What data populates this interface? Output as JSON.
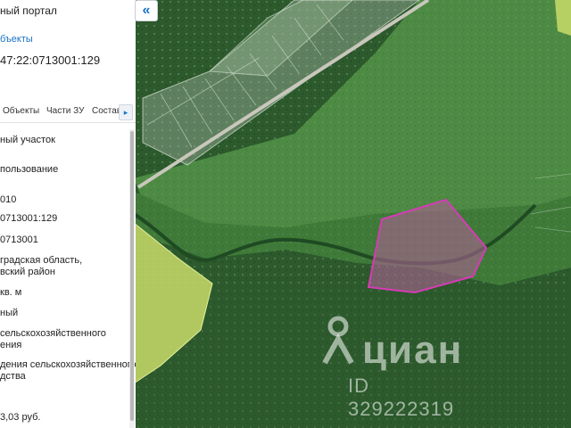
{
  "panel": {
    "portal_title": "ный портал",
    "objects_link": "бъекты",
    "cadastral_number": "47:22:0713001:129",
    "tabs": [
      {
        "label": "Объекты"
      },
      {
        "label": "Части ЗУ"
      },
      {
        "label": "Состав"
      }
    ],
    "tab_next": "▸",
    "fields": {
      "type": "ный участок",
      "usage": "пользование",
      "code": "010",
      "number": "0713001:129",
      "quarter": "0713001",
      "address_line1": "градская область,",
      "address_line2": "вский район",
      "area_unit": "кв. м",
      "status": "ный",
      "category_line1": "сельскохозяйственного",
      "category_line2": "ения",
      "permitted_line1": "дения сельскохозяйственного",
      "permitted_line2": "дства",
      "cost": "3,03 руб."
    }
  },
  "map": {
    "collapse_label": "«",
    "watermark_brand": "циан",
    "watermark_id": "ID 329222319"
  },
  "colors": {
    "link": "#1a73c7",
    "parcel_fill": "#a8638f",
    "parcel_stroke": "#d63bb5",
    "yellow_parcel": "#c9dc6a"
  },
  "icons": {
    "collapse": "double-chevron-left-icon",
    "watermark": "cian-logo-icon"
  }
}
